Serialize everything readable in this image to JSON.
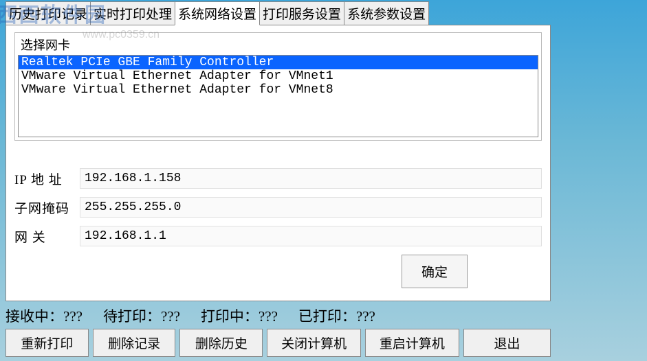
{
  "watermark": {
    "text": "西西软件园",
    "url": "www.pc0359.cn"
  },
  "tabs": [
    {
      "label": "历史打印记录"
    },
    {
      "label": "实时打印处理"
    },
    {
      "label": "系统网络设置"
    },
    {
      "label": "打印服务设置"
    },
    {
      "label": "系统参数设置"
    }
  ],
  "nic": {
    "group_label": "选择网卡",
    "items": [
      "Realtek PCIe GBE Family Controller",
      "VMware Virtual Ethernet Adapter for VMnet1",
      "VMware Virtual Ethernet Adapter for VMnet8"
    ]
  },
  "form": {
    "ip_label": "IP 地 址",
    "ip_value": "192.168.1.158",
    "mask_label": "子网掩码",
    "mask_value": "255.255.255.0",
    "gw_label": "网    关",
    "gw_value": "192.168.1.1",
    "confirm": "确定"
  },
  "status": {
    "receiving": "接收中：???",
    "pending": "待打印：???",
    "printing": "打印中：???",
    "printed": "已打印：???"
  },
  "buttons": {
    "reprint": "重新打印",
    "delete_record": "删除记录",
    "delete_history": "删除历史",
    "shutdown": "关闭计算机",
    "restart": "重启计算机",
    "exit": "退出"
  }
}
